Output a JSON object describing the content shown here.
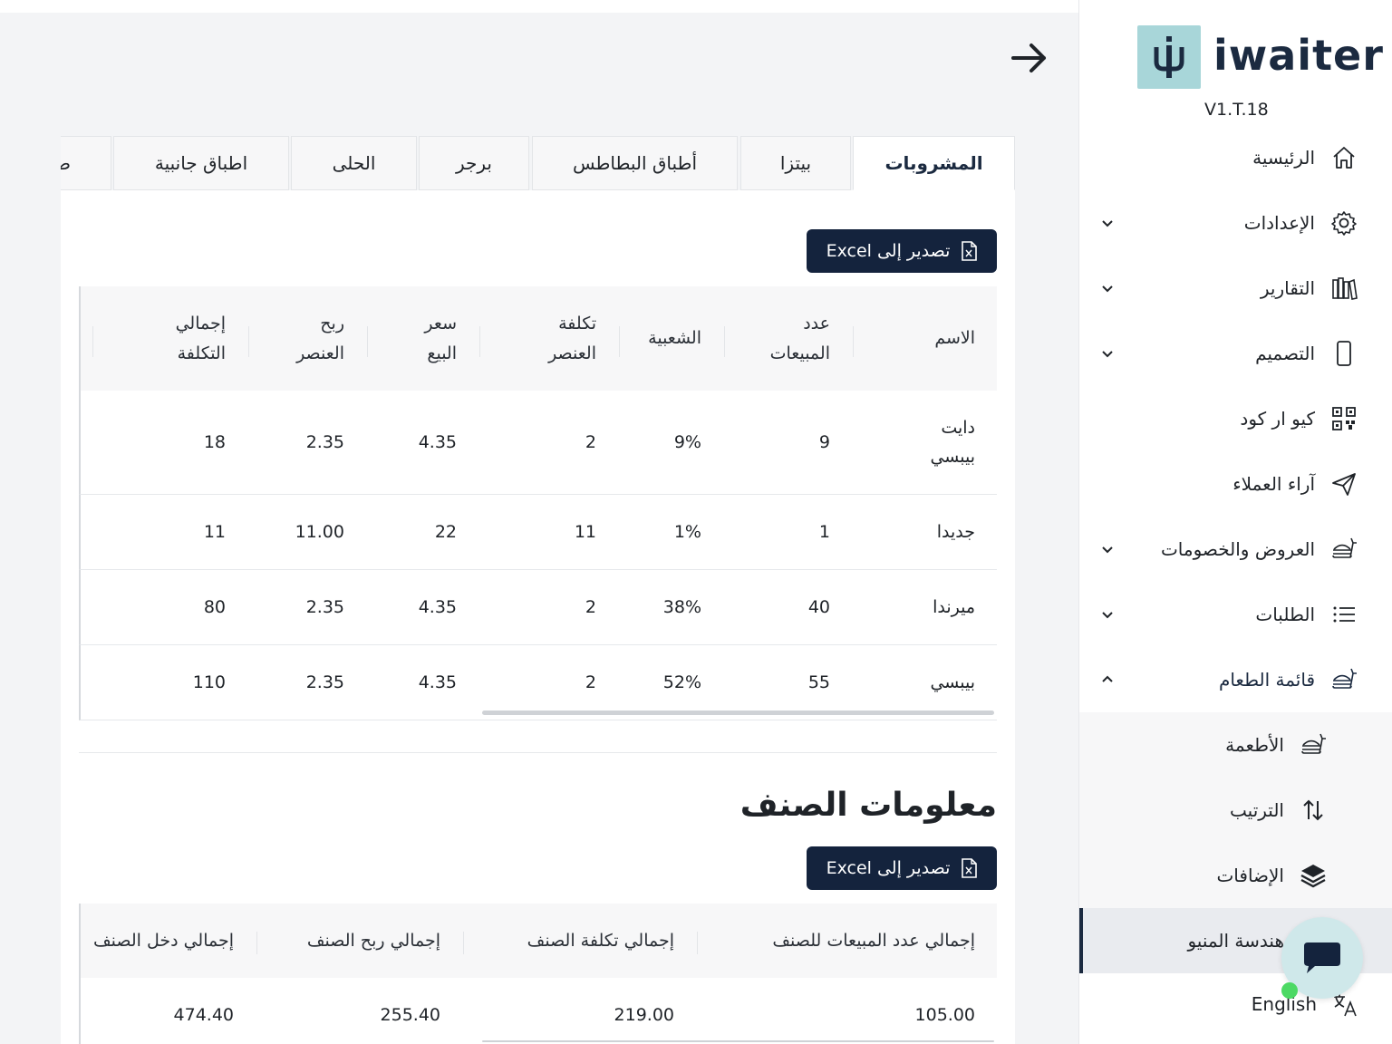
{
  "app": {
    "logo_text": "iwaiter",
    "version": "V1.T.18"
  },
  "sidebar": {
    "items": [
      {
        "label": "الرئيسية",
        "icon": "home-icon"
      },
      {
        "label": "الإعدادات",
        "icon": "gear-icon"
      },
      {
        "label": "التقارير",
        "icon": "reports-icon"
      },
      {
        "label": "التصميم",
        "icon": "mobile-icon"
      },
      {
        "label": "كيو ار كود",
        "icon": "qr-code-icon"
      },
      {
        "label": "آراء العملاء",
        "icon": "send-icon"
      },
      {
        "label": "العروض والخصومات",
        "icon": "food-icon"
      },
      {
        "label": "الطلبات",
        "icon": "list-icon"
      },
      {
        "label": "قائمة الطعام",
        "icon": "food-icon"
      }
    ],
    "submenu": [
      {
        "label": "الأطعمة",
        "icon": "food-icon"
      },
      {
        "label": "الترتيب",
        "icon": "sort-icon"
      },
      {
        "label": "الإضافات",
        "icon": "layers-icon"
      },
      {
        "label": "هندسة المنيو",
        "icon": ""
      }
    ],
    "language": "English"
  },
  "tabs": [
    "المشروبات",
    "بيتزا",
    "أطباق البطاطس",
    "برجر",
    "الحلى",
    "اطباق جانبية",
    "ص"
  ],
  "export_label": "تصدير إلى Excel",
  "items_table": {
    "columns": [
      "الاسم",
      "عدد المبيعات",
      "الشعبية",
      "تكلفة العنصر",
      "سعر البيع",
      "ربح العنصر",
      "إجمالي التكلفة"
    ],
    "rows": [
      [
        "دايت بيبسي",
        "9",
        "9%",
        "2",
        "4.35",
        "2.35",
        "18"
      ],
      [
        "جديدا",
        "1",
        "1%",
        "11",
        "22",
        "11.00",
        "11"
      ],
      [
        "ميرندا",
        "40",
        "38%",
        "2",
        "4.35",
        "2.35",
        "80"
      ],
      [
        "بيبسي",
        "55",
        "52%",
        "2",
        "4.35",
        "2.35",
        "110"
      ]
    ]
  },
  "category_info": {
    "title": "معلومات الصنف",
    "columns": [
      "إجمالي عدد المبيعات للصنف",
      "إجمالي تكلفة الصنف",
      "إجمالي ربح الصنف",
      "إجمالي دخل الصنف"
    ],
    "rows": [
      [
        "105.00",
        "219.00",
        "255.40",
        "474.40"
      ]
    ]
  },
  "colors": {
    "primary": "#14233d",
    "logo_bg": "#a8d6d9",
    "online": "#4cd964"
  }
}
